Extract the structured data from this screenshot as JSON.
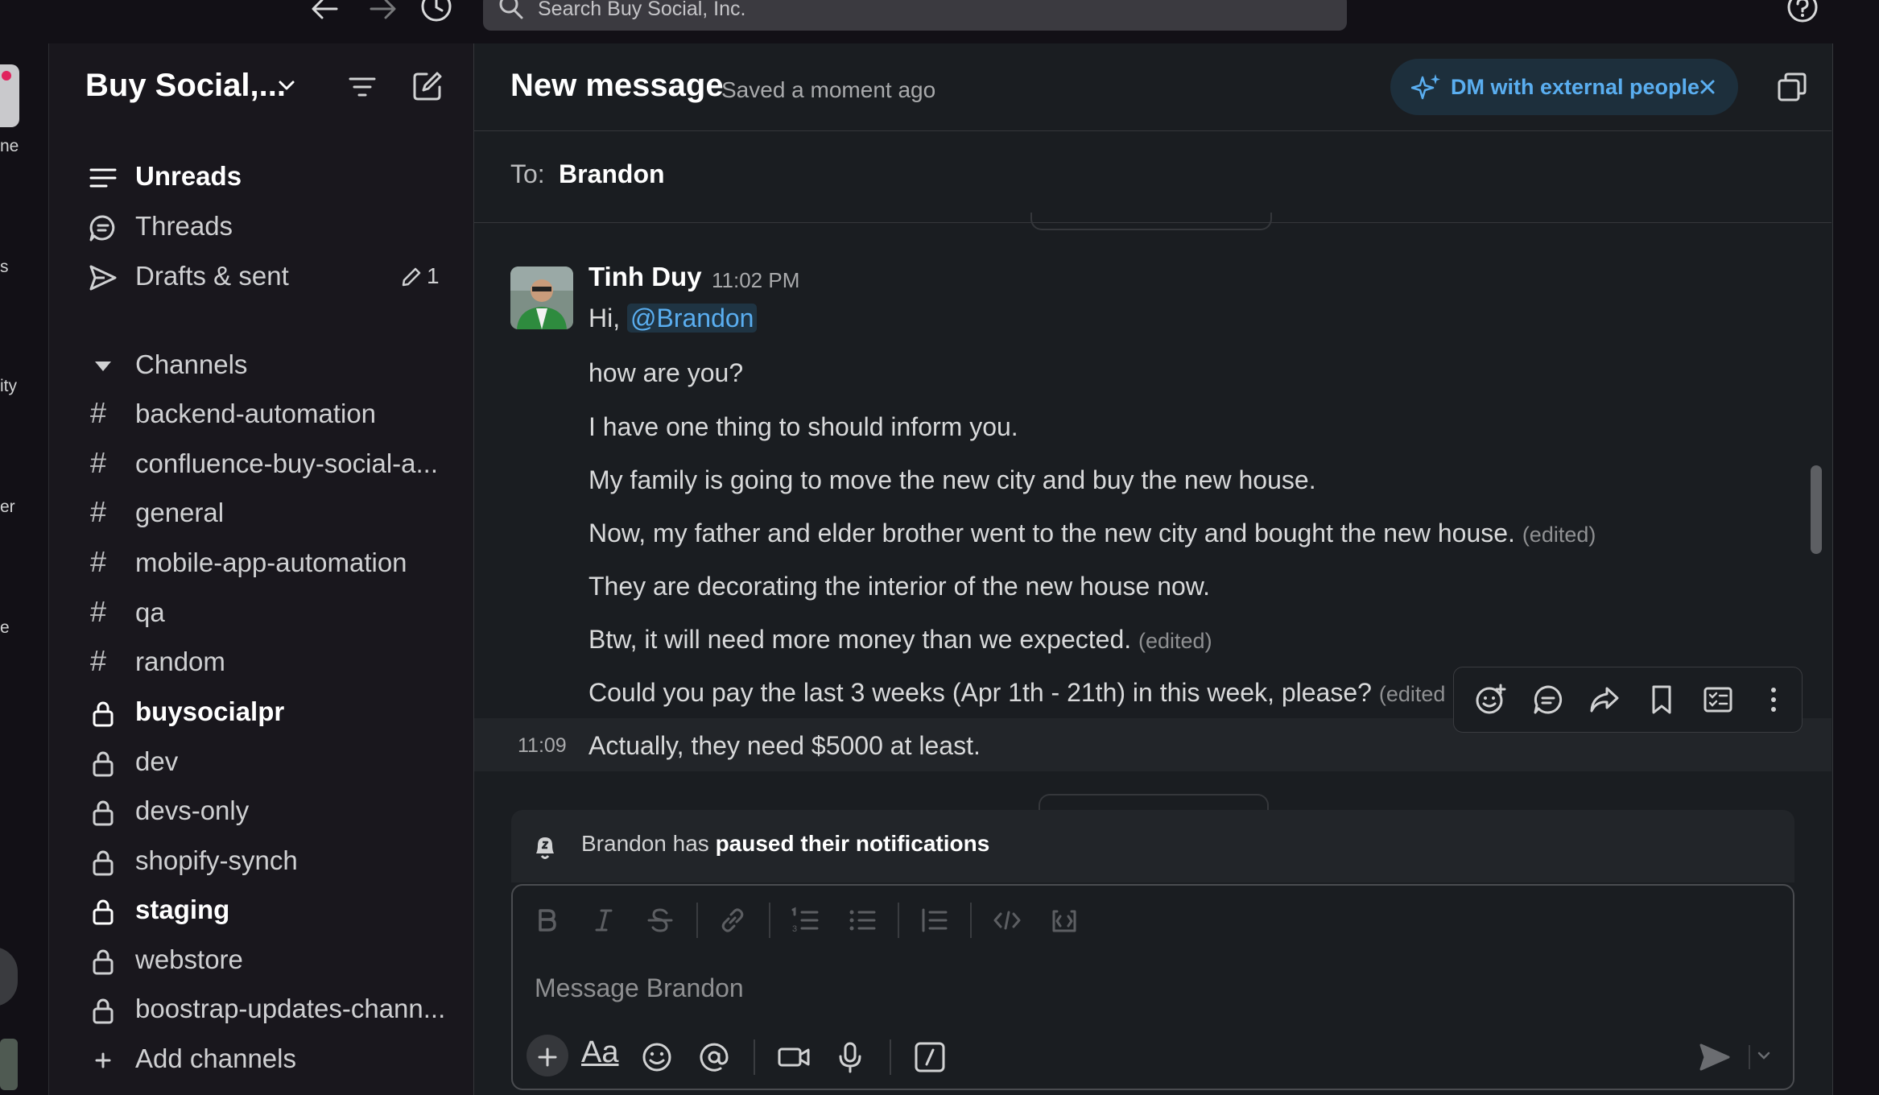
{
  "topbar": {
    "search_placeholder": "Search Buy Social, Inc."
  },
  "rail": {
    "labels": [
      "ne",
      "s",
      "ity",
      "er",
      "e"
    ]
  },
  "sidebar": {
    "workspace_name": "Buy Social,...",
    "nav": [
      {
        "label": "Unreads",
        "icon": "unreads-icon"
      },
      {
        "label": "Threads",
        "icon": "threads-icon"
      },
      {
        "label": "Drafts & sent",
        "icon": "send-icon",
        "count": "1"
      }
    ],
    "channels_header": "Channels",
    "channels": [
      {
        "name": "backend-automation",
        "type": "public",
        "bold": false
      },
      {
        "name": "confluence-buy-social-a...",
        "type": "public",
        "bold": false
      },
      {
        "name": "general",
        "type": "public",
        "bold": false
      },
      {
        "name": "mobile-app-automation",
        "type": "public",
        "bold": false
      },
      {
        "name": "qa",
        "type": "public",
        "bold": false
      },
      {
        "name": "random",
        "type": "public",
        "bold": false
      },
      {
        "name": "buysocialpr",
        "type": "private",
        "bold": true
      },
      {
        "name": "dev",
        "type": "private",
        "bold": false
      },
      {
        "name": "devs-only",
        "type": "private",
        "bold": false
      },
      {
        "name": "shopify-synch",
        "type": "private",
        "bold": false
      },
      {
        "name": "staging",
        "type": "private",
        "bold": true
      },
      {
        "name": "webstore",
        "type": "private",
        "bold": false
      },
      {
        "name": "boostrap-updates-chann...",
        "type": "private",
        "bold": false
      }
    ],
    "add_channels": "Add channels"
  },
  "header": {
    "title": "New message",
    "saved": "Saved a moment ago",
    "dm_external": "DM with external people"
  },
  "to": {
    "label": "To:",
    "recipient": "Brandon"
  },
  "messages": {
    "author": "Tinh Duy",
    "time": "11:02 PM",
    "greeting": "Hi,",
    "mention": "@Brandon",
    "lines": [
      {
        "text": "how are you?",
        "edited": ""
      },
      {
        "text": "I have one thing to should inform you.",
        "edited": ""
      },
      {
        "text": "My family is going to move the new city and buy the new house.",
        "edited": ""
      },
      {
        "text": "Now, my father and elder brother went to the new city and bought the new house.",
        "edited": "(edited)"
      },
      {
        "text": "They are decorating the interior of the new house now.",
        "edited": ""
      },
      {
        "text": "Btw, it will need more money than we expected.",
        "edited": "(edited)"
      },
      {
        "text": "Could you pay the last 3 weeks (Apr 1th - 21th) in this week, please?",
        "edited": "(edited"
      }
    ],
    "last_time": "11:09",
    "last_text": "Actually, they need $5000 at least."
  },
  "notice": {
    "prefix": "Brandon has",
    "bold": "paused their notifications"
  },
  "composer": {
    "placeholder": "Message Brandon",
    "format_label": "Aa"
  },
  "colors": {
    "background": "#1a1d21",
    "sidebar": "#19171d",
    "accent_link": "#5aaef0"
  }
}
